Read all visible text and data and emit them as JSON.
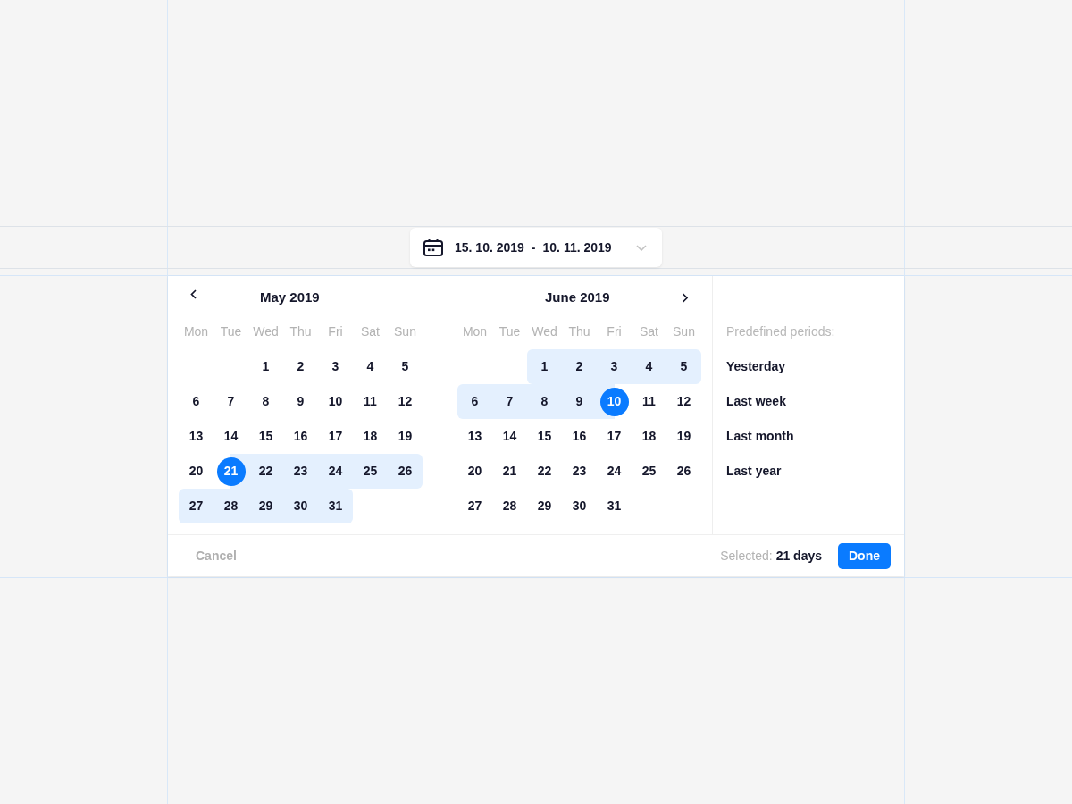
{
  "date_field": {
    "start": "15. 10. 2019",
    "separator": "-",
    "end": "10. 11. 2019"
  },
  "calendar": {
    "months": [
      {
        "title": "May 2019",
        "kind": "prev",
        "weekdays": [
          "Mon",
          "Tue",
          "Wed",
          "Thu",
          "Fri",
          "Sat",
          "Sun"
        ],
        "weeks": [
          [
            {
              "label": "1",
              "selected": false,
              "in_range": false
            },
            {
              "label": "2",
              "selected": false,
              "in_range": false
            },
            {
              "label": "3",
              "selected": false,
              "in_range": false
            },
            {
              "label": "4",
              "selected": false,
              "in_range": false
            },
            {
              "label": "5",
              "selected": false,
              "in_range": false
            }
          ],
          [
            {
              "label": "6",
              "selected": false,
              "in_range": false
            },
            {
              "label": "7",
              "selected": false,
              "in_range": false
            },
            {
              "label": "8",
              "selected": false,
              "in_range": false
            },
            {
              "label": "9",
              "selected": false,
              "in_range": false
            },
            {
              "label": "10",
              "selected": false,
              "in_range": false
            },
            {
              "label": "11",
              "selected": false,
              "in_range": false
            },
            {
              "label": "12",
              "selected": false,
              "in_range": false
            }
          ],
          [
            {
              "label": "13",
              "selected": false,
              "in_range": false
            },
            {
              "label": "14",
              "selected": false,
              "in_range": false
            },
            {
              "label": "15",
              "selected": false,
              "in_range": false
            },
            {
              "label": "16",
              "selected": false,
              "in_range": false
            },
            {
              "label": "17",
              "selected": false,
              "in_range": false
            },
            {
              "label": "18",
              "selected": false,
              "in_range": false
            },
            {
              "label": "19",
              "selected": false,
              "in_range": false
            }
          ],
          [
            {
              "label": "20",
              "selected": false,
              "in_range": false
            },
            {
              "label": "21",
              "selected": true,
              "in_range": true
            },
            {
              "label": "22",
              "selected": false,
              "in_range": true
            },
            {
              "label": "23",
              "selected": false,
              "in_range": true
            },
            {
              "label": "24",
              "selected": false,
              "in_range": true
            },
            {
              "label": "25",
              "selected": false,
              "in_range": true
            },
            {
              "label": "26",
              "selected": false,
              "in_range": true
            }
          ],
          [
            {
              "label": "27",
              "selected": false,
              "in_range": true
            },
            {
              "label": "28",
              "selected": false,
              "in_range": true
            },
            {
              "label": "29",
              "selected": false,
              "in_range": true
            },
            {
              "label": "30",
              "selected": false,
              "in_range": true
            },
            {
              "label": "31",
              "selected": false,
              "in_range": true
            }
          ]
        ]
      },
      {
        "title": "June 2019",
        "kind": "next",
        "weekdays": [
          "Mon",
          "Tue",
          "Wed",
          "Thu",
          "Fri",
          "Sat",
          "Sun"
        ],
        "weeks": [
          [
            {
              "label": "1",
              "selected": false,
              "in_range": true
            },
            {
              "label": "2",
              "selected": false,
              "in_range": true
            },
            {
              "label": "3",
              "selected": false,
              "in_range": true
            },
            {
              "label": "4",
              "selected": false,
              "in_range": true
            },
            {
              "label": "5",
              "selected": false,
              "in_range": true
            }
          ],
          [
            {
              "label": "6",
              "selected": false,
              "in_range": true
            },
            {
              "label": "7",
              "selected": false,
              "in_range": true
            },
            {
              "label": "8",
              "selected": false,
              "in_range": true
            },
            {
              "label": "9",
              "selected": false,
              "in_range": true
            },
            {
              "label": "10",
              "selected": true,
              "in_range": true
            },
            {
              "label": "11",
              "selected": false,
              "in_range": false
            },
            {
              "label": "12",
              "selected": false,
              "in_range": false
            }
          ],
          [
            {
              "label": "13",
              "selected": false,
              "in_range": false
            },
            {
              "label": "14",
              "selected": false,
              "in_range": false
            },
            {
              "label": "15",
              "selected": false,
              "in_range": false
            },
            {
              "label": "16",
              "selected": false,
              "in_range": false
            },
            {
              "label": "17",
              "selected": false,
              "in_range": false
            },
            {
              "label": "18",
              "selected": false,
              "in_range": false
            },
            {
              "label": "19",
              "selected": false,
              "in_range": false
            }
          ],
          [
            {
              "label": "20",
              "selected": false,
              "in_range": false
            },
            {
              "label": "21",
              "selected": false,
              "in_range": false
            },
            {
              "label": "22",
              "selected": false,
              "in_range": false
            },
            {
              "label": "23",
              "selected": false,
              "in_range": false
            },
            {
              "label": "24",
              "selected": false,
              "in_range": false
            },
            {
              "label": "25",
              "selected": false,
              "in_range": false
            },
            {
              "label": "26",
              "selected": false,
              "in_range": false
            }
          ],
          [
            {
              "label": "27",
              "selected": false,
              "in_range": false
            },
            {
              "label": "28",
              "selected": false,
              "in_range": false
            },
            {
              "label": "29",
              "selected": false,
              "in_range": false
            },
            {
              "label": "30",
              "selected": false,
              "in_range": false
            },
            {
              "label": "31",
              "selected": false,
              "in_range": false
            }
          ]
        ]
      }
    ]
  },
  "presets": {
    "heading": "Predefined periods:",
    "items": [
      "Yesterday",
      "Last week",
      "Last month",
      "Last year"
    ]
  },
  "footer": {
    "cancel": "Cancel",
    "selected_label": "Selected:",
    "selected_value": "21 days",
    "done": "Done"
  }
}
